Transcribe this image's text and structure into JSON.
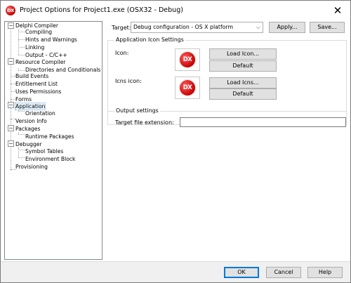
{
  "window": {
    "title": "Project Options for Project1.exe  (OSX32 - Debug)",
    "icon_text": "DX"
  },
  "tree": {
    "items": [
      {
        "label": "Delphi Compiler",
        "expandable": true,
        "expanded": true
      },
      {
        "label": "Compiling"
      },
      {
        "label": "Hints and Warnings"
      },
      {
        "label": "Linking"
      },
      {
        "label": "Output - C/C++"
      },
      {
        "label": "Resource Compiler",
        "expandable": true,
        "expanded": true
      },
      {
        "label": "Directories and Conditionals"
      },
      {
        "label": "Build Events"
      },
      {
        "label": "Entitlement List"
      },
      {
        "label": "Uses Permissions"
      },
      {
        "label": "Forms"
      },
      {
        "label": "Application",
        "expandable": true,
        "expanded": true,
        "selected": true
      },
      {
        "label": "Orientation"
      },
      {
        "label": "Version Info"
      },
      {
        "label": "Packages",
        "expandable": true,
        "expanded": true
      },
      {
        "label": "Runtime Packages"
      },
      {
        "label": "Debugger",
        "expandable": true,
        "expanded": true
      },
      {
        "label": "Symbol Tables"
      },
      {
        "label": "Environment Block"
      },
      {
        "label": "Provisioning"
      }
    ],
    "expander_symbol": "−"
  },
  "target": {
    "label": "Target:",
    "selected": "Debug configuration - OS X platform",
    "apply_label": "Apply...",
    "save_label": "Save..."
  },
  "app_icon_settings": {
    "title": "Application Icon Settings",
    "icon_label": "Icon:",
    "icns_label": "Icns icon:",
    "load_icon_label": "Load Icon...",
    "load_icns_label": "Load Icns...",
    "default_label": "Default",
    "logo_text": "DX"
  },
  "output_settings": {
    "title": "Output settings",
    "extension_label": "Target file extension:",
    "extension_value": ""
  },
  "dialog_buttons": {
    "ok": "OK",
    "cancel": "Cancel",
    "help": "Help"
  },
  "colors": {
    "accent": "#0078d7",
    "selection_bg": "#e5f3ff",
    "logo_red": "#c90000",
    "button_bg": "#e1e1e1",
    "footer_bg": "#f0f0f0"
  },
  "icons": {
    "close": "close-icon",
    "dropdown": "chevron-down-icon",
    "app": "delphi-app-icon"
  }
}
